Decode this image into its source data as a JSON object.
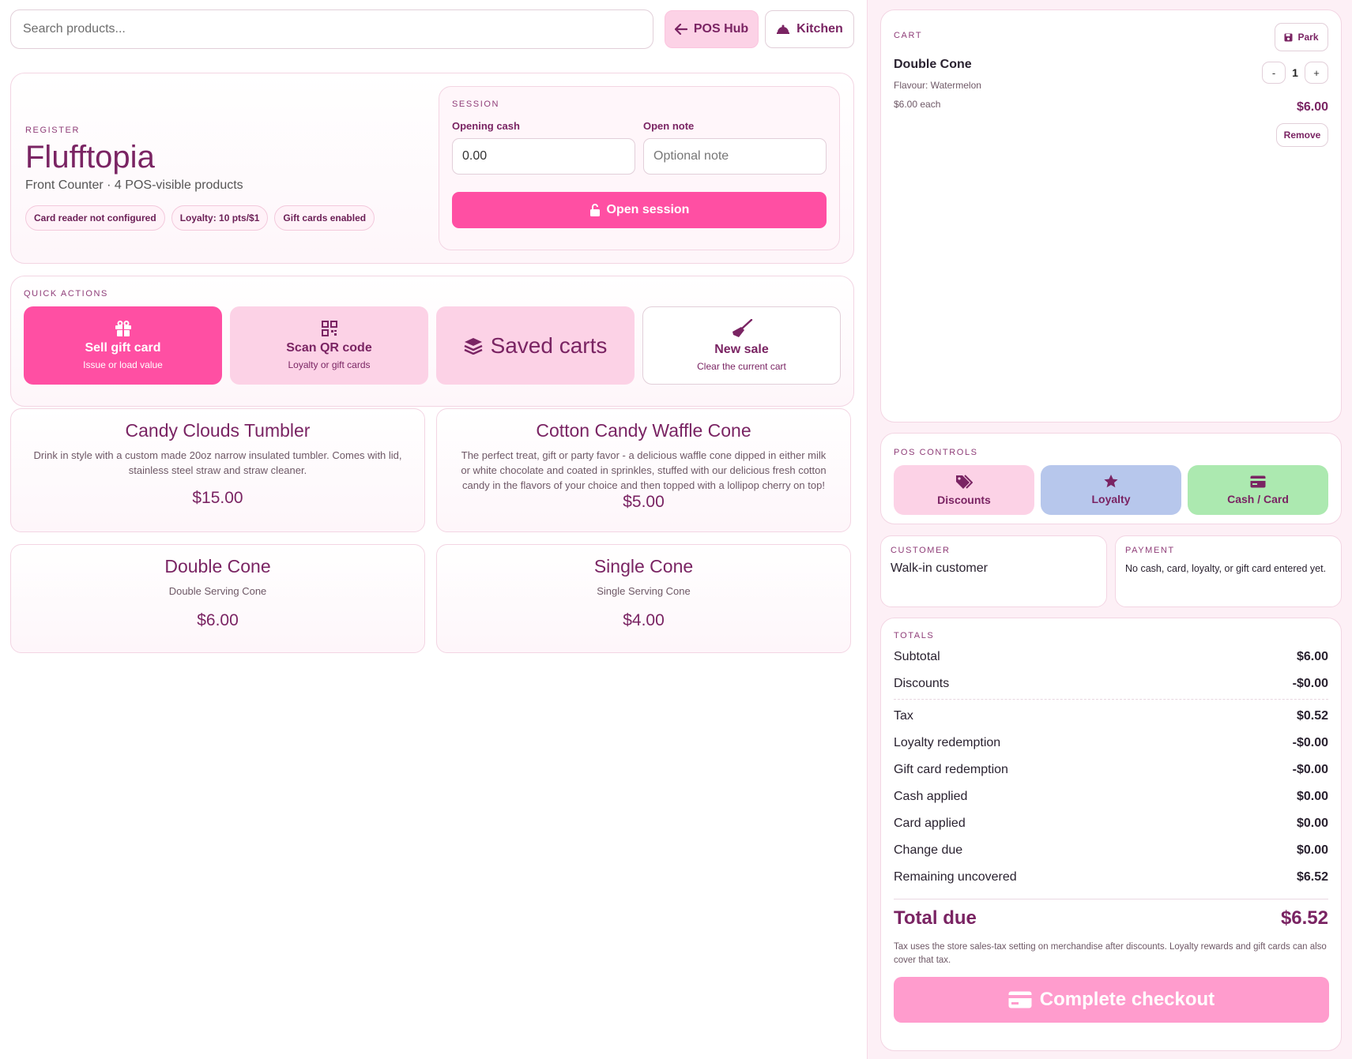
{
  "topbar": {
    "search_placeholder": "Search products...",
    "pos_hub_label": "POS Hub",
    "kitchen_label": "Kitchen"
  },
  "register": {
    "eyebrow": "REGISTER",
    "store_name": "Flufftopia",
    "subtitle": "Front Counter · 4 POS-visible products",
    "chips": [
      "Card reader not configured",
      "Loyalty: 10 pts/$1",
      "Gift cards enabled"
    ]
  },
  "session": {
    "eyebrow": "SESSION",
    "opening_cash_label": "Opening cash",
    "opening_cash_value": "0.00",
    "open_note_label": "Open note",
    "open_note_placeholder": "Optional note",
    "open_button": "Open session"
  },
  "quick_actions": {
    "eyebrow": "QUICK ACTIONS",
    "gift": {
      "title": "Sell gift card",
      "sub": "Issue or load value"
    },
    "qr": {
      "title": "Scan QR code",
      "sub": "Loyalty or gift cards"
    },
    "saved": {
      "title": "Saved carts"
    },
    "newsale": {
      "title": "New sale",
      "sub": "Clear the current cart"
    }
  },
  "products": [
    {
      "name": "Candy Clouds Tumbler",
      "desc": "Drink in style with a custom made 20oz narrow insulated tumbler. Comes with lid, stainless steel straw and straw cleaner.",
      "price": "$15.00"
    },
    {
      "name": "Cotton Candy Waffle Cone",
      "desc": "The perfect treat, gift or party favor - a delicious waffle cone dipped in either milk or white chocolate and coated in sprinkles, stuffed with our delicious fresh cotton candy in the flavors of your choice and then topped with a lollipop cherry on top!",
      "price": "$5.00"
    },
    {
      "name": "Double Cone",
      "desc": "Double Serving Cone",
      "price": "$6.00"
    },
    {
      "name": "Single Cone",
      "desc": "Single Serving Cone",
      "price": "$4.00"
    }
  ],
  "cart": {
    "eyebrow": "CART",
    "park_label": "Park",
    "item": {
      "name": "Double Cone",
      "flavour": "Flavour: Watermelon",
      "unit": "$6.00 each",
      "qty": "1",
      "minus": "-",
      "plus": "+",
      "total": "$6.00",
      "remove": "Remove"
    }
  },
  "pos_controls": {
    "eyebrow": "POS CONTROLS",
    "discounts": "Discounts",
    "loyalty": "Loyalty",
    "cash_card": "Cash / Card"
  },
  "customer": {
    "eyebrow": "CUSTOMER",
    "value": "Walk-in customer"
  },
  "payment": {
    "eyebrow": "PAYMENT",
    "value": "No cash, card, loyalty, or gift card entered yet."
  },
  "totals": {
    "eyebrow": "TOTALS",
    "rows_a": [
      {
        "label": "Subtotal",
        "value": "$6.00"
      },
      {
        "label": "Discounts",
        "value": "-$0.00"
      }
    ],
    "rows_b": [
      {
        "label": "Tax",
        "value": "$0.52"
      },
      {
        "label": "Loyalty redemption",
        "value": "-$0.00"
      },
      {
        "label": "Gift card redemption",
        "value": "-$0.00"
      },
      {
        "label": "Cash applied",
        "value": "$0.00"
      },
      {
        "label": "Card applied",
        "value": "$0.00"
      },
      {
        "label": "Change due",
        "value": "$0.00"
      },
      {
        "label": "Remaining uncovered",
        "value": "$6.52"
      }
    ],
    "total_due_label": "Total due",
    "total_due_value": "$6.52",
    "tax_note": "Tax uses the store sales-tax setting on merchandise after discounts. Loyalty rewards and gift cards can also cover that tax.",
    "checkout_label": "Complete checkout"
  },
  "colors": {
    "brand": "#7a2463",
    "accent_pink": "#ff4fa3",
    "soft_pink": "#fcd2e6",
    "loyalty_blue": "#b7c7ec",
    "cash_green": "#ace9b0",
    "checkout_disabled": "#ff9ccd"
  },
  "icons": [
    "arrow-left-icon",
    "bell-icon",
    "unlock-icon",
    "gift-icon",
    "qrcode-icon",
    "layers-icon",
    "broom-icon",
    "save-icon",
    "tags-icon",
    "star-icon",
    "credit-card-icon"
  ]
}
